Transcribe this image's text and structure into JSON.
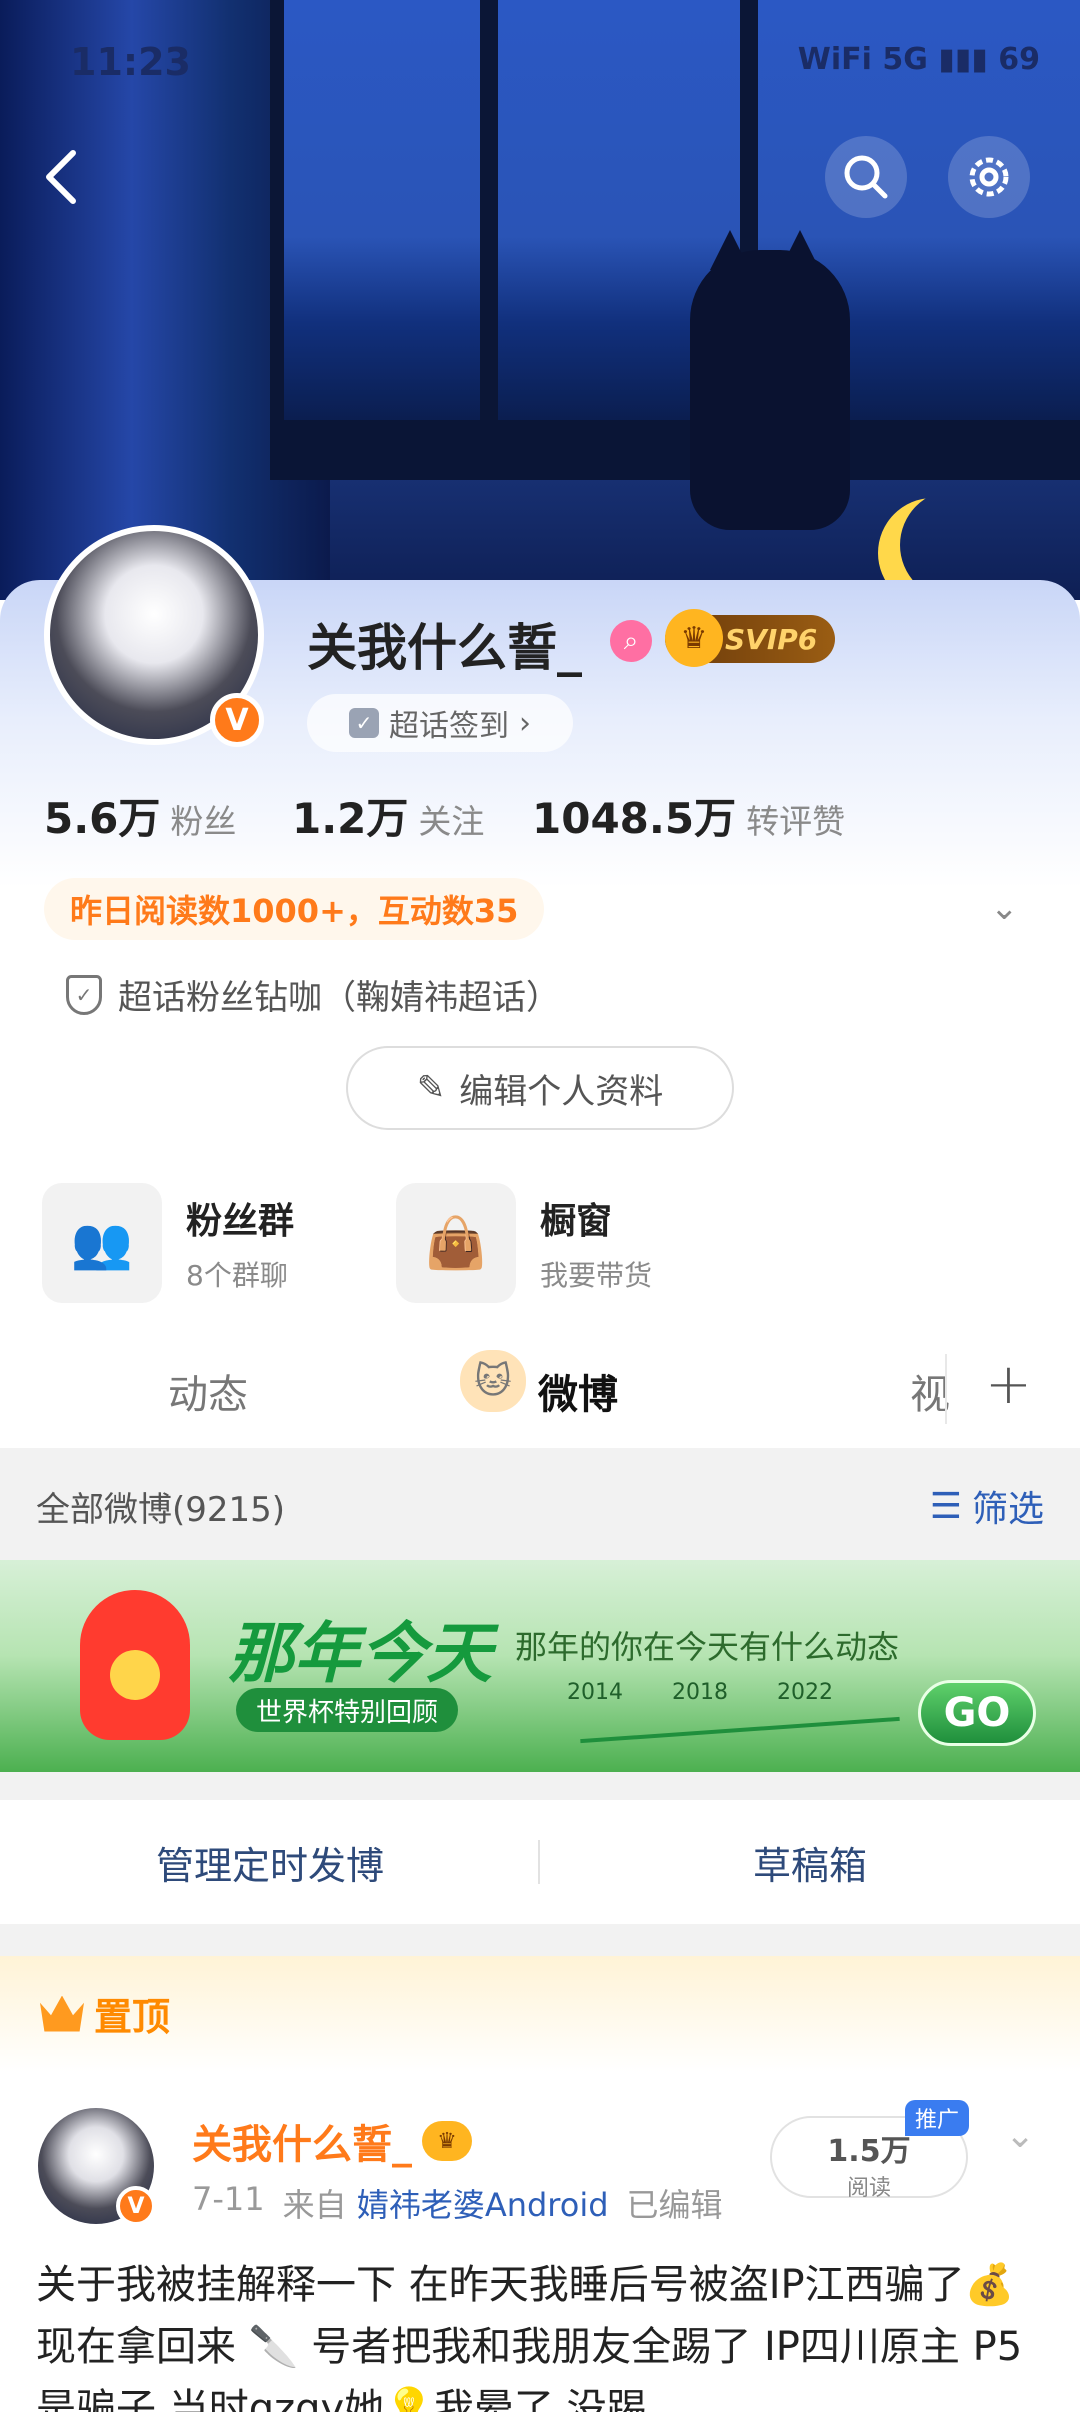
{
  "status_bar": {
    "time": "11:23",
    "icons": "WiFi 5G ▮▮▮ 69"
  },
  "profile": {
    "username": "关我什么誓_",
    "vip_badge": "SVIP6",
    "verified_badge": "V",
    "chaohua_button": "超话签到",
    "stats": [
      {
        "value": "5.6万",
        "label": "粉丝"
      },
      {
        "value": "1.2万",
        "label": "关注"
      },
      {
        "value": "1048.5万",
        "label": "转评赞"
      }
    ],
    "read_stats": "昨日阅读数1000+，互动数35",
    "fan_title": "超话粉丝钻咖（鞠婧祎超话）",
    "edit_button": "编辑个人资料"
  },
  "tools": [
    {
      "title": "粉丝群",
      "subtitle": "8个群聊"
    },
    {
      "title": "橱窗",
      "subtitle": "我要带货"
    }
  ],
  "tabs": {
    "items": [
      "动态",
      "微博",
      "视"
    ],
    "active": "微博"
  },
  "feed": {
    "all_label": "全部微博(9215)",
    "filter_label": "筛选"
  },
  "banner": {
    "title": "那年今天",
    "subtitle": "那年的你在今天有什么动态",
    "pill": "世界杯特别回顾",
    "years": [
      "2014",
      "2018",
      "2022"
    ],
    "go": "GO"
  },
  "management": {
    "schedule": "管理定时发博",
    "drafts": "草稿箱"
  },
  "pinned": {
    "label": "置顶"
  },
  "post": {
    "username": "关我什么誓_",
    "date": "7-11",
    "source_prefix": "来自",
    "source": "婧祎老婆Android",
    "edited": "已编辑",
    "read_count": "1.5万",
    "read_label": "阅读",
    "promo": "推广",
    "text": "关于我被挂解释一下 在昨天我睡后号被盗IP江西骗了💰 现在拿回来 🔪 号者把我和我朋友全踢了 IP四川原主 P5是骗子 当时qzqy她💡我晕了 没踢"
  },
  "colors": {
    "accent_orange": "#ff7a1a",
    "link_blue": "#2e5fb8",
    "banner_green": "#1f8f3c"
  }
}
